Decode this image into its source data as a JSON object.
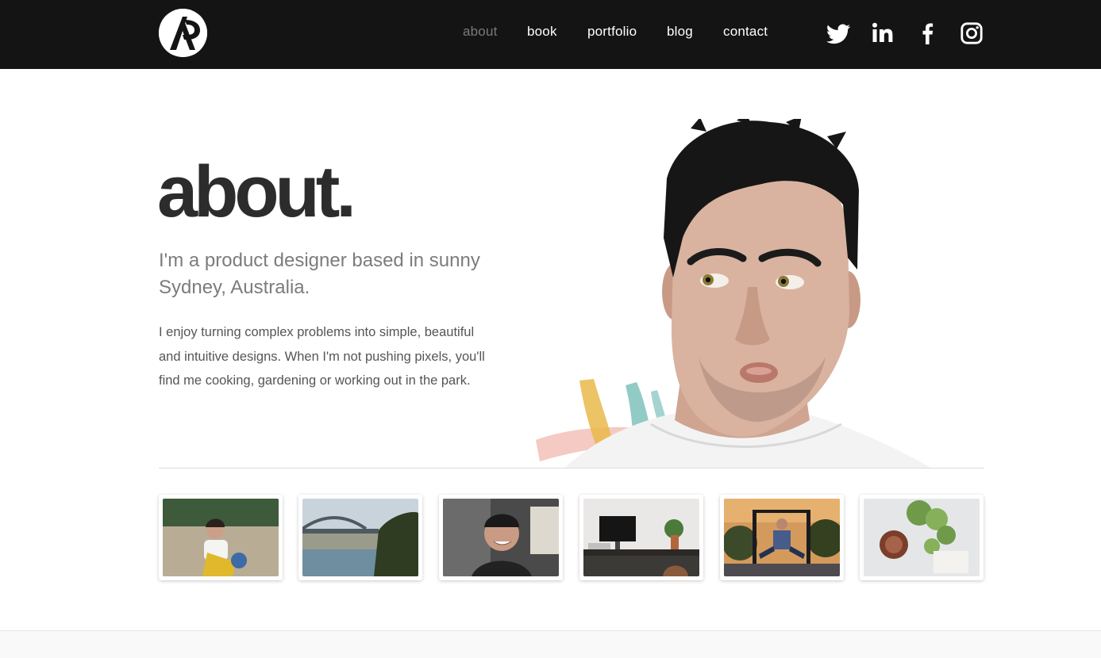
{
  "brand": {
    "logo_icon": "ap-monogram-logo"
  },
  "nav": {
    "items": [
      {
        "label": "about",
        "active": true
      },
      {
        "label": "book",
        "active": false
      },
      {
        "label": "portfolio",
        "active": false
      },
      {
        "label": "blog",
        "active": false
      },
      {
        "label": "contact",
        "active": false
      }
    ]
  },
  "social": [
    {
      "icon": "twitter-icon"
    },
    {
      "icon": "linkedin-icon"
    },
    {
      "icon": "facebook-icon"
    },
    {
      "icon": "instagram-icon"
    }
  ],
  "hero": {
    "title": "about.",
    "lead": "I'm a product designer based in sunny Sydney, Australia.",
    "body": "I enjoy turning complex problems into simple, beautiful and intuitive designs. When I'm not pushing pixels, you'll find me cooking, gardening or working out in the park."
  },
  "colors": {
    "header_bg": "#141414",
    "nav_text": "#ffffff",
    "nav_active": "#7a7a7a",
    "title": "#2c2c2c",
    "lead": "#7c7c7c",
    "body": "#555555"
  },
  "gallery": [
    {
      "subject": "child-on-toy-photo"
    },
    {
      "subject": "sydney-harbour-bridge-photo"
    },
    {
      "subject": "smiling-selfie-photo"
    },
    {
      "subject": "desk-workspace-photo"
    },
    {
      "subject": "park-workout-photo"
    },
    {
      "subject": "plant-and-clock-photo"
    }
  ]
}
